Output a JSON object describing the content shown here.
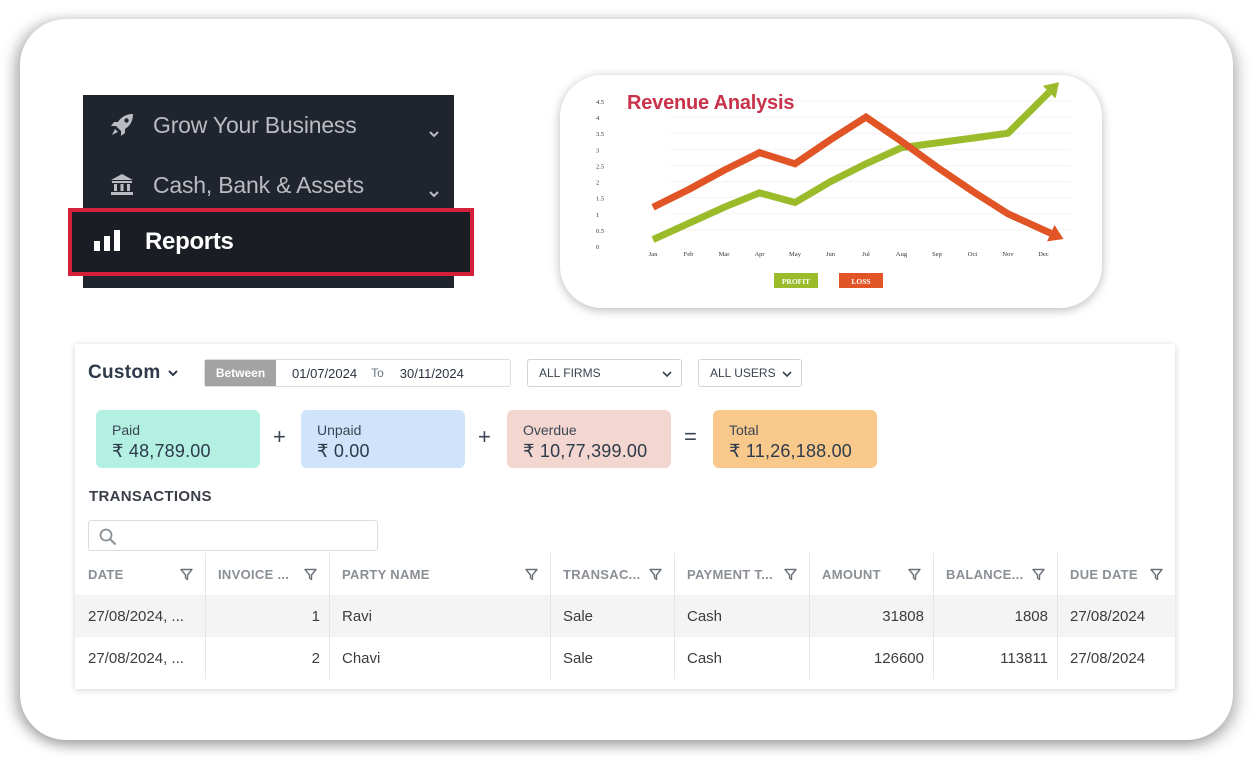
{
  "sidebar": {
    "items": [
      {
        "label": "Grow Your Business",
        "icon": "rocket-icon",
        "expandable": true
      },
      {
        "label": "Cash, Bank & Assets",
        "icon": "bank-icon",
        "expandable": true
      },
      {
        "label": "Reports",
        "icon": "bar-chart-icon",
        "highlighted": true
      }
    ],
    "highlight_color": "#d4203b"
  },
  "chart_data": {
    "type": "line",
    "title": "Revenue Analysis",
    "xlabel": "",
    "ylabel": "",
    "categories": [
      "Jan",
      "Feb",
      "Mar",
      "Apr",
      "May",
      "Jun",
      "Jul",
      "Aug",
      "Sep",
      "Oct",
      "Nov",
      "Dec"
    ],
    "yticks": [
      "0",
      "0.5",
      "1",
      "1.5",
      "2",
      "2.5",
      "3",
      "3.5",
      "4",
      "4.5"
    ],
    "ylim": [
      0,
      4.5
    ],
    "grid": true,
    "legend": "bottom-center",
    "series": [
      {
        "name": "PROFIT",
        "color": "#9bbb2a",
        "values": [
          0.2,
          0.7,
          1.2,
          1.65,
          1.35,
          2.0,
          2.55,
          3.05,
          3.2,
          3.35,
          3.5,
          4.6
        ],
        "arrow_end": true
      },
      {
        "name": "LOSS",
        "color": "#e05425",
        "values": [
          1.2,
          1.75,
          2.35,
          2.9,
          2.55,
          3.3,
          4.0,
          3.25,
          2.45,
          1.7,
          1.0,
          0.5
        ],
        "arrow_end": true
      }
    ]
  },
  "report": {
    "period_label": "Custom",
    "between_label": "Between",
    "from_date": "01/07/2024",
    "to_label": "To",
    "to_date": "30/11/2024",
    "firms_filter": "ALL FIRMS",
    "users_filter": "ALL USERS",
    "summary": {
      "paid": {
        "label": "Paid",
        "value": "₹ 48,789.00",
        "color": "#b3f0e2"
      },
      "unpaid": {
        "label": "Unpaid",
        "value": "₹ 0.00",
        "color": "#cfe4fb"
      },
      "overdue": {
        "label": "Overdue",
        "value": "₹ 10,77,399.00",
        "color": "#f3d6cf"
      },
      "total": {
        "label": "Total",
        "value": "₹ 11,26,188.00",
        "color": "#f9c98c"
      },
      "op_plus": "+",
      "op_equals": "="
    },
    "transactions_title": "TRANSACTIONS",
    "search_placeholder": "",
    "columns": [
      "DATE",
      "INVOICE ...",
      "PARTY NAME",
      "TRANSAC...",
      "PAYMENT T...",
      "AMOUNT",
      "BALANCE...",
      "DUE DATE"
    ],
    "rows": [
      [
        "27/08/2024, ...",
        "1",
        "Ravi",
        "Sale",
        "Cash",
        "31808",
        "1808",
        "27/08/2024"
      ],
      [
        "27/08/2024, ...",
        "2",
        "Chavi",
        "Sale",
        "Cash",
        "126600",
        "113811",
        "27/08/2024"
      ]
    ]
  }
}
